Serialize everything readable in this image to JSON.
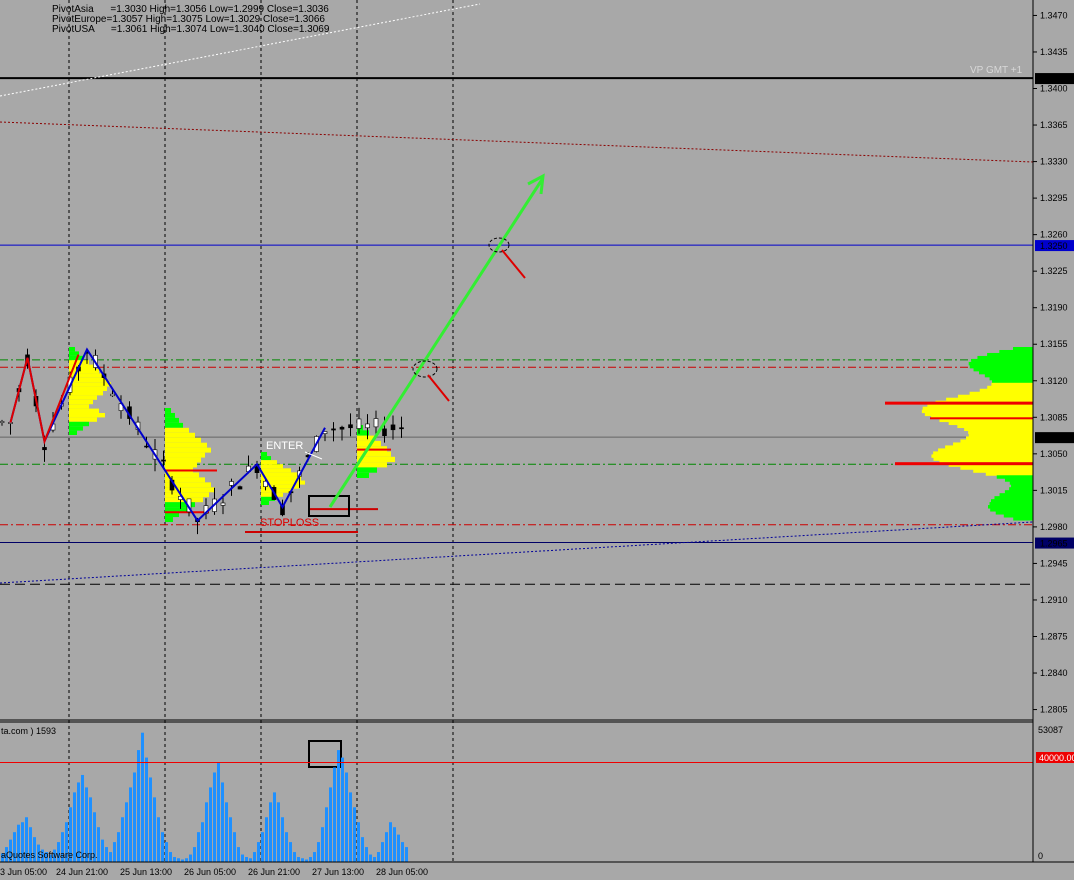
{
  "header": {
    "pivot_asia": "PivotAsia      =1.3030 High=1.3056 Low=1.2999 Close=1.3036",
    "pivot_europe": "PivotEurope=1.3057 High=1.3075 Low=1.3029 Close=1.3066",
    "pivot_usa": "PivotUSA      =1.3061 High=1.3074 Low=1.3040 Close=1.3069"
  },
  "vp_label": "VP GMT +1",
  "annotations": {
    "enter": "ENTER",
    "stoploss": "STOPLOSS"
  },
  "volume_panel": {
    "title_fragment": "ta.com ) 1593",
    "copyright_fragment": "aQuotes Software Corp.",
    "max_label": "53087",
    "zero_label": "0",
    "level_label": "40000.00"
  },
  "colors": {
    "background": "#a8a8a8",
    "volume_bars": "#1e90ff",
    "zigzag": "#0000cc",
    "arrow": "#33ee33",
    "stop_line": "#cc0000",
    "profile_yellow": "#ffff00",
    "profile_green": "#00ff00",
    "profile_red": "#ee0000"
  },
  "chart_data": {
    "type": "candlestick",
    "price_axis": {
      "ticks": [
        "1.3470",
        "1.3435",
        "1.3400",
        "1.3365",
        "1.3330",
        "1.3295",
        "1.3260",
        "1.3225",
        "1.3190",
        "1.3155",
        "1.3120",
        "1.3085",
        "1.3050",
        "1.3015",
        "1.2980",
        "1.2945",
        "1.2910",
        "1.2875",
        "1.2840",
        "1.2805"
      ],
      "ylim": [
        1.2795,
        1.348
      ]
    },
    "time_axis": {
      "labels": [
        "3 Jun 05:00",
        "24 Jun 21:00",
        "25 Jun 13:00",
        "26 Jun 05:00",
        "26 Jun 21:00",
        "27 Jun 13:00",
        "28 Jun 05:00"
      ]
    },
    "price_tags": [
      {
        "label": "1.3410",
        "value": 1.341,
        "style": "black"
      },
      {
        "label": "1.3250",
        "value": 1.325,
        "style": "blue"
      },
      {
        "label": "1.3066",
        "value": 1.3066,
        "style": "black"
      },
      {
        "label": "1.2965",
        "value": 1.2965,
        "style": "navy"
      }
    ],
    "levels": [
      {
        "value": 1.341,
        "color": "#000000",
        "style": "solid"
      },
      {
        "value": 1.325,
        "color": "#0000cc",
        "style": "solid"
      },
      {
        "value": 1.314,
        "color": "#008800",
        "style": "dashdot"
      },
      {
        "value": 1.3133,
        "color": "#cc0000",
        "style": "dashdot"
      },
      {
        "value": 1.3066,
        "color": "#666666",
        "style": "solid"
      },
      {
        "value": 1.304,
        "color": "#008800",
        "style": "dashdot"
      },
      {
        "value": 1.2982,
        "color": "#cc0000",
        "style": "dashdot"
      },
      {
        "value": 1.2965,
        "color": "#000066",
        "style": "solid"
      },
      {
        "value": 1.2925,
        "color": "#000000",
        "style": "dashed"
      }
    ],
    "zigzag_points": [
      [
        1.308,
        1
      ],
      [
        1.3142,
        3
      ],
      [
        1.3062,
        5
      ],
      [
        1.315,
        10
      ],
      [
        1.2986,
        23
      ],
      [
        1.304,
        30
      ],
      [
        1.2999,
        33
      ],
      [
        1.3075,
        38
      ]
    ],
    "target_price": 1.325,
    "stoploss_price": 1.2999,
    "volume": {
      "ylim": [
        0,
        53087
      ],
      "level": 40000,
      "values": [
        3500,
        6000,
        9000,
        12000,
        15000,
        16000,
        18000,
        14000,
        10000,
        7000,
        5000,
        4000,
        3000,
        5000,
        8000,
        12000,
        16000,
        22000,
        28000,
        32000,
        35000,
        30000,
        26000,
        20000,
        14000,
        9000,
        6000,
        4000,
        8000,
        12000,
        18000,
        24000,
        30000,
        36000,
        45000,
        52000,
        42000,
        34000,
        26000,
        18000,
        12000,
        8000,
        4000,
        2000,
        1500,
        1000,
        1500,
        3000,
        6000,
        12000,
        16000,
        24000,
        30000,
        36000,
        40000,
        32000,
        24000,
        18000,
        12000,
        6000,
        3000,
        2000,
        1500,
        4000,
        8000,
        12000,
        18000,
        24000,
        28000,
        24000,
        18000,
        12000,
        8000,
        4000,
        2000,
        1500,
        1000,
        2000,
        4000,
        8000,
        14000,
        22000,
        30000,
        38000,
        45000,
        42000,
        36000,
        28000,
        22000,
        16000,
        10000,
        6000,
        3000,
        2000,
        4000,
        8000,
        12000,
        16000,
        14000,
        11000,
        8000,
        6000
      ]
    }
  }
}
